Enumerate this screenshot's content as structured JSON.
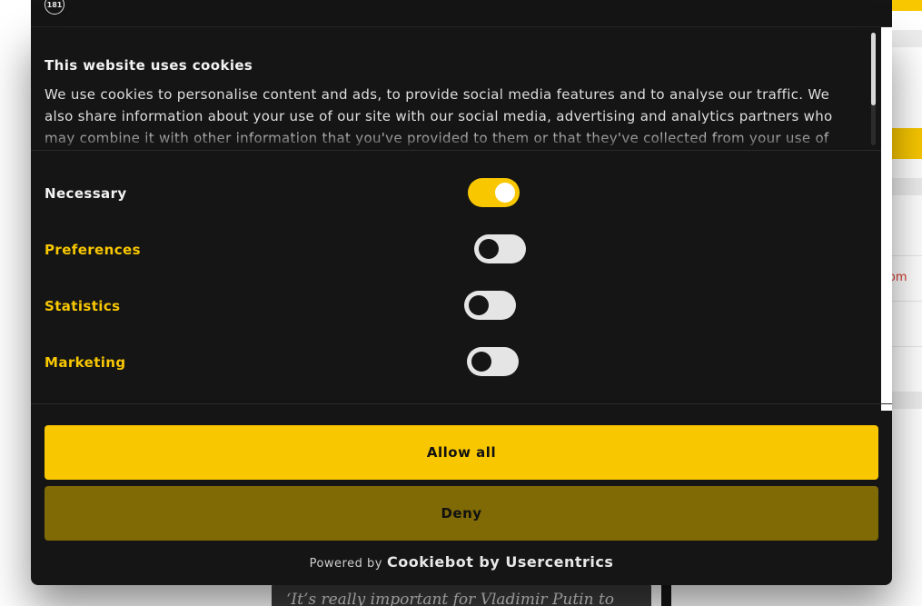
{
  "background": {
    "link_fragment": "le.com",
    "quote_fragment": "‘It’s really important for Vladimir Putin to"
  },
  "header": {
    "logo_icon": "circle-logo-icon"
  },
  "dialog": {
    "title": "This website uses cookies",
    "body": "We use cookies to personalise content and ads, to provide social media features and to analyse our traffic. We also share information about your use of our site with our social media, advertising and analytics partners who may combine it with other information that you've provided to them or that they've collected from your use of their services.",
    "categories": [
      {
        "label": "Necessary",
        "enabled": true
      },
      {
        "label": "Preferences",
        "enabled": false
      },
      {
        "label": "Statistics",
        "enabled": false
      },
      {
        "label": "Marketing",
        "enabled": false
      }
    ],
    "allow_label": "Allow all",
    "deny_label": "Deny",
    "powered_prefix": "Powered by",
    "powered_brand": "Cookiebot by Usercentrics"
  },
  "colors": {
    "accent": "#f8c700",
    "deny_bg": "#7f6a06",
    "label_yellow": "#f8c700",
    "label_white": "#f2f2f2",
    "dialog_bg": "#151515",
    "text": "#111111"
  }
}
